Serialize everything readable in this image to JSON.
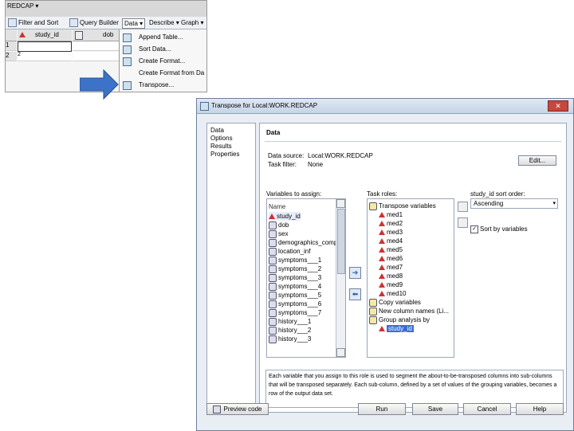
{
  "app": {
    "title": "REDCAP ▾"
  },
  "toolbar": {
    "filter_sort": "Filter and Sort",
    "query_builder": "Query Builder",
    "data_menu": "Data ▾",
    "describe_menu": "Describe ▾",
    "graph_menu": "Graph ▾"
  },
  "grid": {
    "headers": [
      "study_id",
      "dob"
    ],
    "row_numbers": [
      "1",
      "2"
    ],
    "row2_first_value": "2"
  },
  "data_menu": {
    "items": [
      "Append Table...",
      "Sort Data...",
      "Create Format...",
      "Create Format from Da",
      "Transpose..."
    ]
  },
  "dialog": {
    "title": "Transpose for Local:WORK.REDCAP",
    "close_icon": "close-icon",
    "nav": [
      "Data",
      "Options",
      "Results",
      "Properties"
    ],
    "section_title": "Data",
    "data_source_label": "Data source:",
    "data_source_value": "Local:WORK.REDCAP",
    "task_filter_label": "Task filter:",
    "task_filter_value": "None",
    "edit_button": "Edit...",
    "variables_label": "Variables to assign:",
    "name_header": "Name",
    "variables": [
      "study_id",
      "dob",
      "sex",
      "demographics_comple",
      "location_inf",
      "symptoms___1",
      "symptoms___2",
      "symptoms___3",
      "symptoms___4",
      "symptoms___5",
      "symptoms___6",
      "symptoms___7",
      "history___1",
      "history___2",
      "history___3"
    ],
    "roles_label": "Task roles:",
    "roles": {
      "transpose_title": "Transpose variables",
      "transpose_items": [
        "med1",
        "med2",
        "med3",
        "med4",
        "med5",
        "med6",
        "med7",
        "med8",
        "med9",
        "med10"
      ],
      "copy_variables": "Copy variables",
      "new_column_names": "New column names (Li...",
      "group_by": "Group analysis by",
      "group_item": "study_id"
    },
    "sort_order_label": "study_id sort order:",
    "sort_order_value": "Ascending",
    "sort_by_variables": "Sort by variables",
    "description": "Each variable that you assign to this role is used to segment the about-to-be-transposed columns into sub-columns that will be transposed separately. Each sub-column, defined by a set of values of the grouping variables, becomes a row of the output data set.",
    "preview_button": "Preview code",
    "run_button": "Run",
    "save_button": "Save",
    "cancel_button": "Cancel",
    "help_button": "Help"
  },
  "colors": {
    "accent_arrow": "#3c73c8",
    "selection": "#3a6fd0",
    "close": "#c8463b"
  }
}
